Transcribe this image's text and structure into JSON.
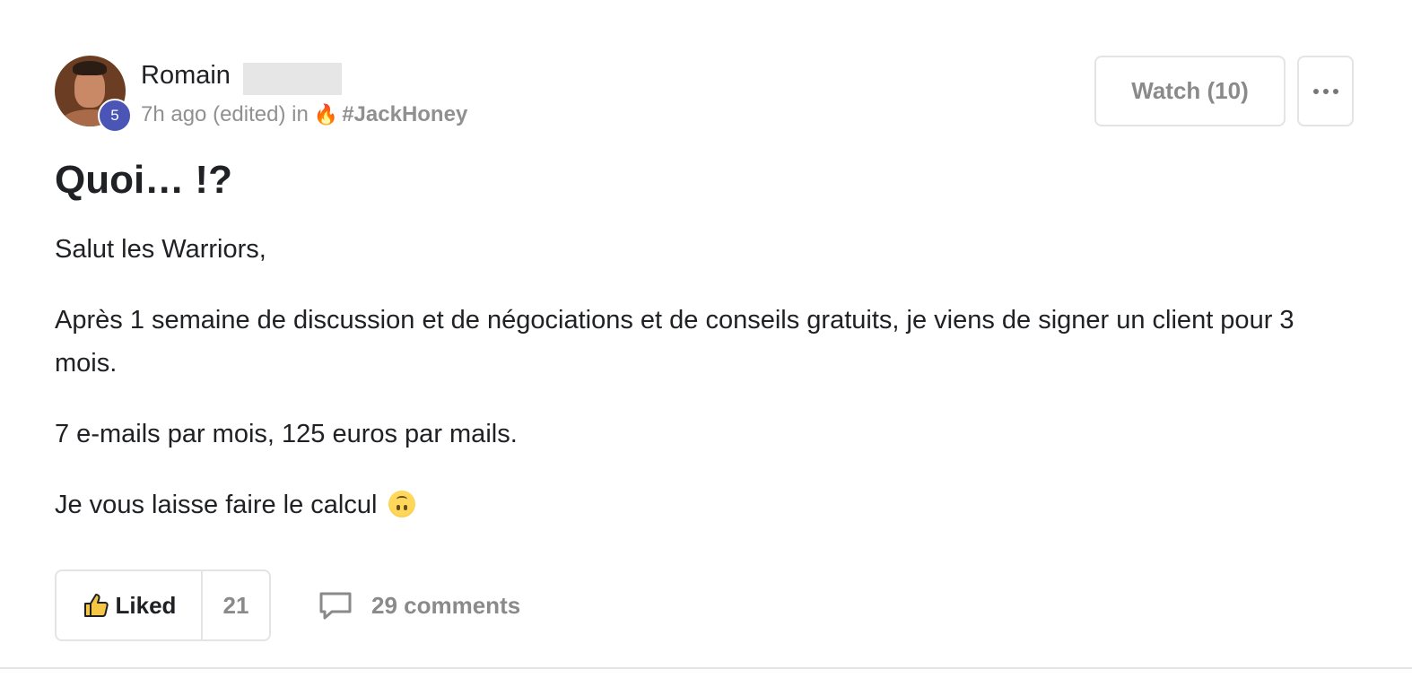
{
  "post": {
    "author": {
      "name": "Romain",
      "level": "5"
    },
    "meta": {
      "time": "7h ago (edited) in",
      "category_emoji": "🔥",
      "category": "#JackHoney"
    },
    "actions": {
      "watch_label": "Watch (10)"
    },
    "title": "Quoi… !?",
    "paragraphs": [
      "Salut les Warriors,",
      "Après 1 semaine de discussion et de négociations et de conseils gratuits, je viens de signer un client pour 3 mois.",
      "7 e-mails par mois, 125 euros par mails.",
      "Je vous laisse faire le calcul"
    ],
    "footer": {
      "like_label": "Liked",
      "like_count": "21",
      "comments_label": "29 comments"
    }
  }
}
